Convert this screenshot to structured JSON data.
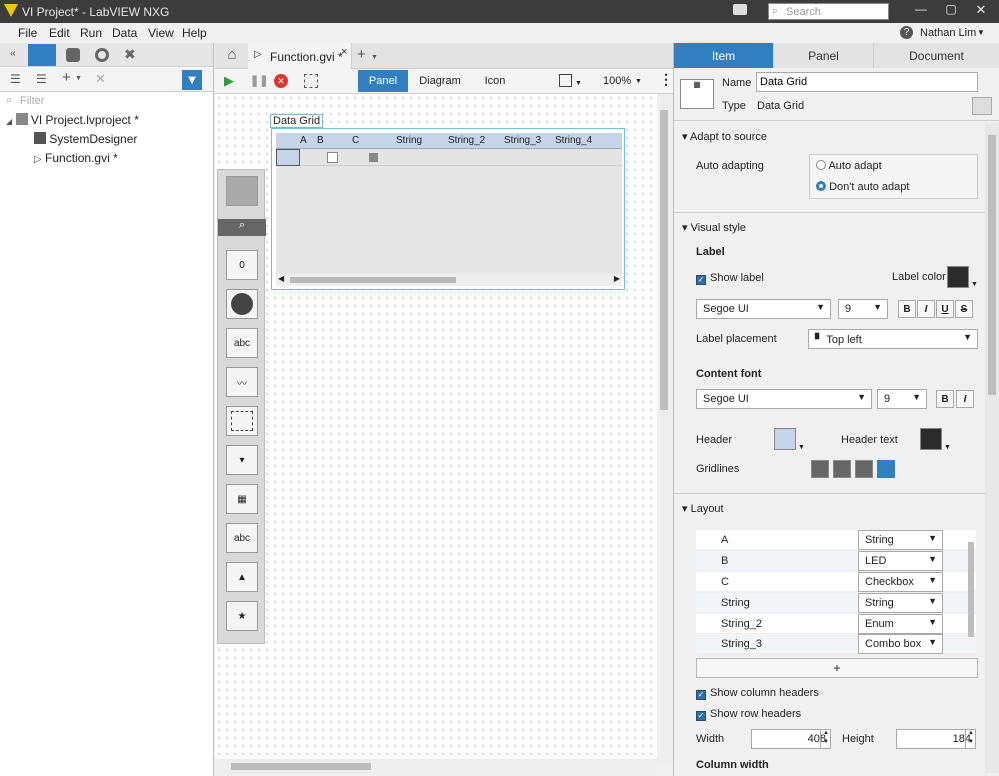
{
  "window": {
    "title": "VI Project* - LabVIEW NXG",
    "search_placeholder": "Search",
    "user": "Nathan Lim"
  },
  "menu": [
    "File",
    "Edit",
    "Run",
    "Data",
    "View",
    "Help"
  ],
  "left": {
    "filter_placeholder": "Filter",
    "tree": [
      {
        "label": "VI Project.lvproject *",
        "level": 0
      },
      {
        "label": "SystemDesigner",
        "level": 1
      },
      {
        "label": "Function.gvi *",
        "level": 1
      }
    ]
  },
  "center": {
    "tab_label": "Function.gvi *",
    "views": [
      "Panel",
      "Diagram",
      "Icon"
    ],
    "zoom": "100%",
    "grid": {
      "label": "Data Grid",
      "columns": [
        "A",
        "B",
        "C",
        "String",
        "String_2",
        "String_3",
        "String_4"
      ]
    }
  },
  "right": {
    "tabs": [
      "Item",
      "Panel",
      "Document"
    ],
    "name_label": "Name",
    "name_value": "Data Grid",
    "type_label": "Type",
    "type_value": "Data Grid",
    "adapt": {
      "title": "Adapt to source",
      "label": "Auto adapting",
      "opt1": "Auto adapt",
      "opt2": "Don't auto adapt"
    },
    "visual": {
      "title": "Visual style",
      "label_h": "Label",
      "show_label": "Show label",
      "label_color": "Label color",
      "font": "Segoe UI",
      "size": "9",
      "bold": "B",
      "italic": "I",
      "underline": "U",
      "strike": "S",
      "placement_label": "Label placement",
      "placement": "Top left",
      "content_font_h": "Content font",
      "content_font": "Segoe UI",
      "content_size": "9",
      "header": "Header",
      "header_text": "Header text",
      "gridlines": "Gridlines"
    },
    "layout": {
      "title": "Layout",
      "rows": [
        {
          "name": "A",
          "type": "String"
        },
        {
          "name": "B",
          "type": "LED"
        },
        {
          "name": "C",
          "type": "Checkbox"
        },
        {
          "name": "String",
          "type": "String"
        },
        {
          "name": "String_2",
          "type": "Enum"
        },
        {
          "name": "String_3",
          "type": "Combo box"
        }
      ],
      "add": "+",
      "show_col": "Show column headers",
      "show_row": "Show row headers",
      "width_label": "Width",
      "width": "408",
      "height_label": "Height",
      "height": "184",
      "colwidth": "Column width"
    }
  },
  "colors": {
    "accent": "#2f7fc1",
    "header": "#c5d4e6",
    "label_color": "#2b2b2b"
  }
}
